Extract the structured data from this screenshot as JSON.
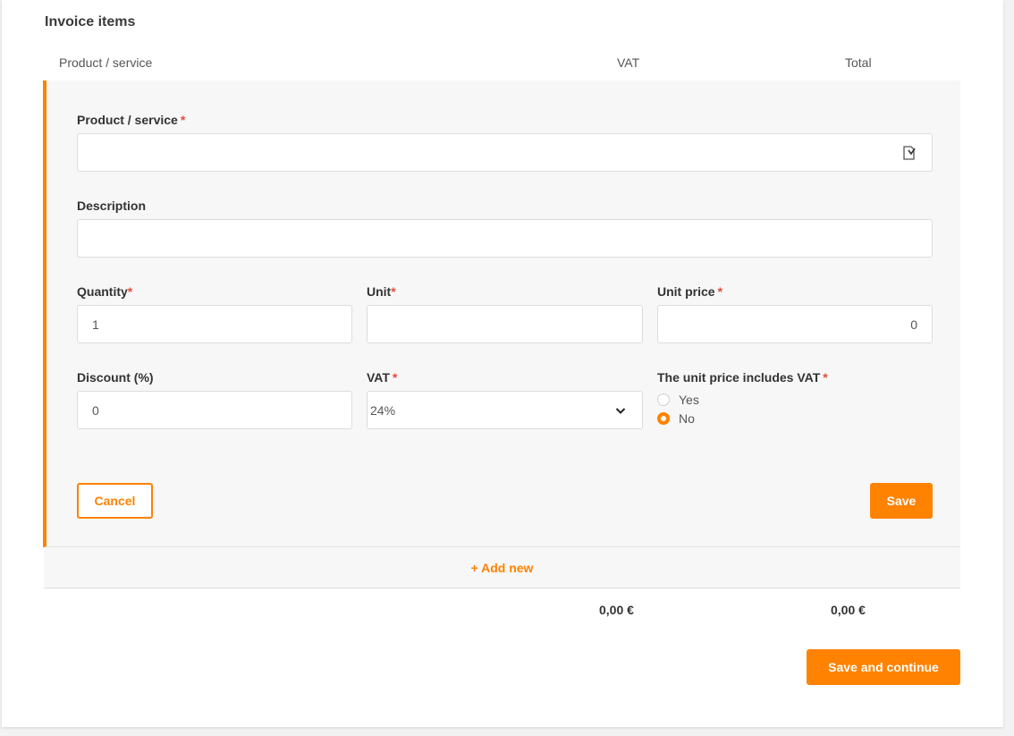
{
  "section": {
    "title": "Invoice items"
  },
  "table": {
    "headers": {
      "product": "Product / service",
      "vat": "VAT",
      "total": "Total"
    }
  },
  "form": {
    "product": {
      "label": "Product / service",
      "required": "*",
      "value": ""
    },
    "description": {
      "label": "Description",
      "value": ""
    },
    "quantity": {
      "label": "Quantity",
      "required": "*",
      "value": "1"
    },
    "unit": {
      "label": "Unit",
      "required": "*",
      "value": ""
    },
    "unit_price": {
      "label": "Unit price",
      "required": "*",
      "value": "0"
    },
    "discount": {
      "label": "Discount (%)",
      "value": "0"
    },
    "vat": {
      "label": "VAT",
      "required": "*",
      "selected": "24%"
    },
    "includes_vat": {
      "label": "The unit price includes VAT",
      "required": "*",
      "options": [
        "Yes",
        "No"
      ],
      "selected": "No"
    },
    "cancel_label": "Cancel",
    "save_label": "Save"
  },
  "add_new_label": "+ Add new",
  "totals": {
    "vat": "0,00 €",
    "total": "0,00 €"
  },
  "save_continue_label": "Save and continue",
  "colors": {
    "accent": "#ff8200",
    "required": "#e74c3c"
  }
}
